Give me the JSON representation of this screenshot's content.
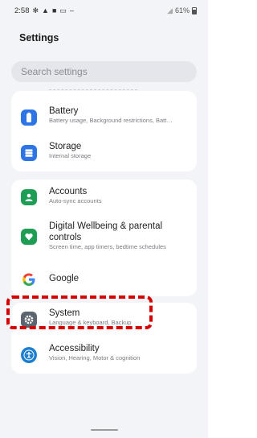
{
  "status_bar": {
    "time": "2:58",
    "battery_text": "61%",
    "icons": [
      "gear-icon",
      "warning-icon",
      "lock-icon",
      "notification-icon",
      "dash-icon"
    ]
  },
  "header": {
    "title": "Settings"
  },
  "search": {
    "placeholder": "Search settings"
  },
  "items": [
    {
      "label": "Battery",
      "sub": "Battery usage, Background restrictions, Batt…",
      "icon": "battery-icon",
      "color": "#2d74e6"
    },
    {
      "label": "Storage",
      "sub": "Internal storage",
      "icon": "storage-icon",
      "color": "#2d74e6"
    },
    {
      "label": "Accounts",
      "sub": "Auto-sync accounts",
      "icon": "accounts-icon",
      "color": "#1e9e55"
    },
    {
      "label": "Digital Wellbeing & parental",
      "label2": "controls",
      "sub": "Screen time, app timers, bedtime schedules",
      "icon": "wellbeing-icon",
      "color": "#1e9e55"
    },
    {
      "label": "Google",
      "sub": "",
      "icon": "google-icon",
      "color": "#4285f4"
    },
    {
      "label": "System",
      "sub": "Language & keyboard, Backup",
      "icon": "system-icon",
      "color": "#5d6570"
    },
    {
      "label": "Accessibility",
      "sub": "Vision, Hearing, Motor & cognition",
      "icon": "accessibility-icon",
      "color": "#1e7fcf"
    }
  ]
}
